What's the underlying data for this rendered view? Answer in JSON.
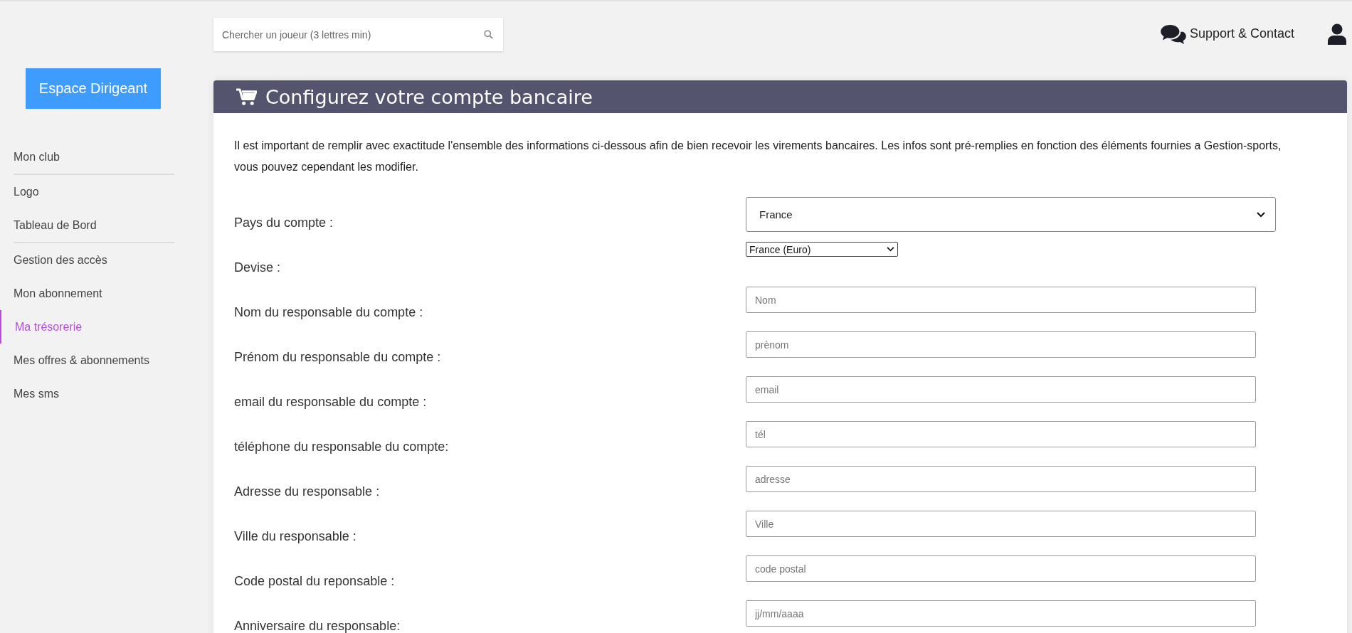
{
  "search": {
    "placeholder": "Chercher un joueur (3 lettres min)"
  },
  "top_links": [
    {
      "label": "Support & Contact"
    }
  ],
  "sidebar": {
    "brand_button": "Espace Dirigeant",
    "items": [
      {
        "label": "Mon club",
        "selected": false,
        "divider_after": true
      },
      {
        "label": "Logo",
        "selected": false,
        "divider_after": false
      },
      {
        "label": "Tableau de Bord",
        "selected": false,
        "divider_after": true
      },
      {
        "label": "Gestion des accès",
        "selected": false,
        "divider_after": false
      },
      {
        "label": "Mon abonnement",
        "selected": false,
        "divider_after": false
      },
      {
        "label": "Ma trésorerie",
        "selected": true,
        "divider_after": false
      },
      {
        "label": "Mes offres & abonnements",
        "selected": false,
        "divider_after": false
      },
      {
        "label": "Mes sms",
        "selected": false,
        "divider_after": false
      }
    ]
  },
  "card": {
    "title": "Configurez votre compte bancaire",
    "intro": "Il est important de remplir avec exactitude l'ensemble des informations ci-dessous afin de bien recevoir les virements bancaires. Les infos sont pré-remplies en fonction des éléments fournies a Gestion-sports, vous pouvez cependant les modifier.",
    "fields": [
      {
        "kind": "select",
        "label": "Pays du compte :",
        "value": "France"
      },
      {
        "kind": "select-small",
        "label": "Devise :",
        "value": "France (Euro)"
      },
      {
        "kind": "input",
        "label": "Nom du responsable du compte :",
        "placeholder": "Nom"
      },
      {
        "kind": "input",
        "label": "Prénom du responsable du compte :",
        "placeholder": "prènom"
      },
      {
        "kind": "input",
        "label": "email du responsable du compte :",
        "placeholder": "email"
      },
      {
        "kind": "input",
        "label": "téléphone du responsable du compte:",
        "placeholder": "tél"
      },
      {
        "kind": "input",
        "label": "Adresse du responsable :",
        "placeholder": "adresse"
      },
      {
        "kind": "input",
        "label": "Ville du responsable :",
        "placeholder": "Ville"
      },
      {
        "kind": "input",
        "label": "Code postal du reponsable :",
        "placeholder": "code postal"
      },
      {
        "kind": "input",
        "label": "Anniversaire du responsable:",
        "placeholder": "jj/mm/aaaa"
      }
    ]
  }
}
